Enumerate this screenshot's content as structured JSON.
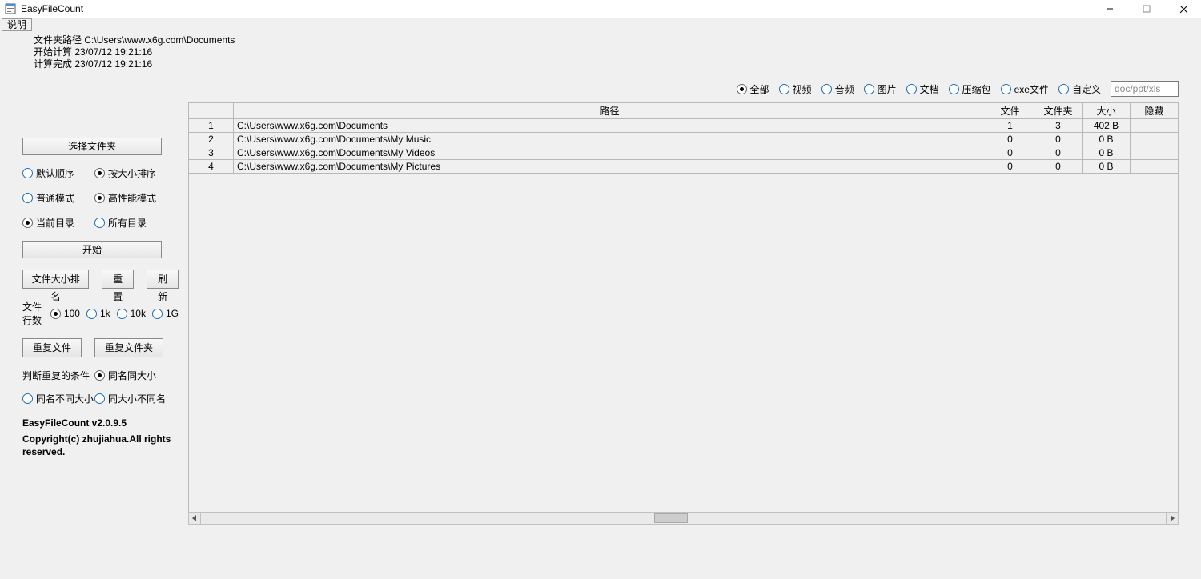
{
  "window": {
    "title": "EasyFileCount"
  },
  "menu": {
    "help": "说明"
  },
  "info": {
    "path_label": "文件夹路径",
    "path_value": "C:\\Users\\www.x6g.com\\Documents",
    "start_label": "开始计算",
    "start_time": "23/07/12 19:21:16",
    "done_label": "计算完成",
    "done_time": "23/07/12 19:21:16"
  },
  "filters": {
    "all": "全部",
    "video": "视频",
    "audio": "音频",
    "image": "图片",
    "document": "文档",
    "archive": "压缩包",
    "exe": "exe文件",
    "custom": "自定义",
    "custom_placeholder": "doc/ppt/xls"
  },
  "table": {
    "headers": {
      "index": "",
      "path": "路径",
      "files": "文件",
      "folders": "文件夹",
      "size": "大小",
      "hidden": "隐藏"
    },
    "rows": [
      {
        "idx": "1",
        "path": "C:\\Users\\www.x6g.com\\Documents",
        "files": "1",
        "folders": "3",
        "size": "402 B",
        "hidden": ""
      },
      {
        "idx": "2",
        "path": "C:\\Users\\www.x6g.com\\Documents\\My Music",
        "files": "0",
        "folders": "0",
        "size": "0 B",
        "hidden": ""
      },
      {
        "idx": "3",
        "path": "C:\\Users\\www.x6g.com\\Documents\\My Videos",
        "files": "0",
        "folders": "0",
        "size": "0 B",
        "hidden": ""
      },
      {
        "idx": "4",
        "path": "C:\\Users\\www.x6g.com\\Documents\\My Pictures",
        "files": "0",
        "folders": "0",
        "size": "0 B",
        "hidden": ""
      }
    ]
  },
  "sidebar": {
    "choose_folder": "选择文件夹",
    "sort_default": "默认顺序",
    "sort_size": "按大小排序",
    "mode_normal": "普通模式",
    "mode_perf": "高性能模式",
    "dir_current": "当前目录",
    "dir_all": "所有目录",
    "start": "开始",
    "filesize_rank": "文件大小排名",
    "reset": "重置",
    "refresh": "刷新",
    "rowcount_label": "文件行数",
    "rc_100": "100",
    "rc_1k": "1k",
    "rc_10k": "10k",
    "rc_1g": "1G",
    "dup_files": "重复文件",
    "dup_folders": "重复文件夹",
    "dup_cond_label": "判断重复的条件",
    "dup_same_name_size": "同名同大小",
    "dup_same_name_diff_size": "同名不同大小",
    "dup_same_size_diff_name": "同大小不同名",
    "version": "EasyFileCount v2.0.9.5",
    "copyright": "Copyright(c) zhujiahua.All rights reserved."
  }
}
